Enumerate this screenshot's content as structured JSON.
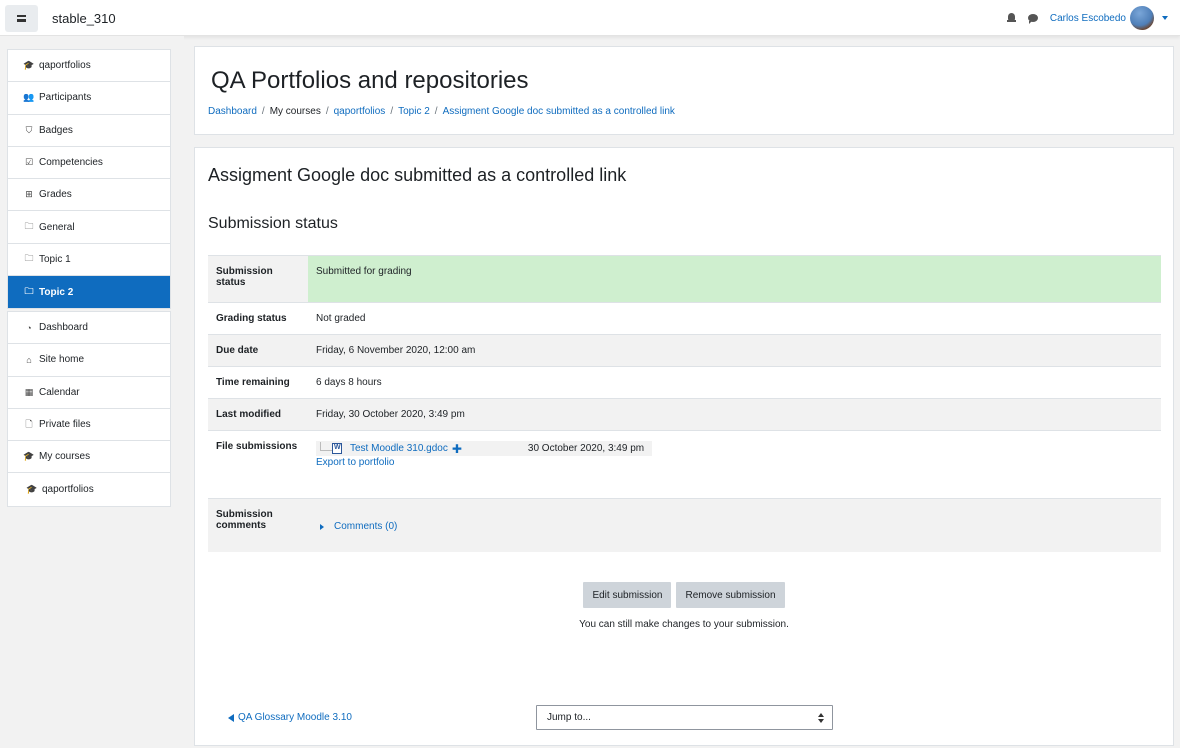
{
  "navbar": {
    "site_name": "stable_310",
    "user_name": "Carlos Escobedo"
  },
  "drawer": {
    "course_group": [
      {
        "label": "qaportfolios",
        "icon": "graduation-cap-icon"
      },
      {
        "label": "Participants",
        "icon": "users-icon"
      },
      {
        "label": "Badges",
        "icon": "shield-icon"
      },
      {
        "label": "Competencies",
        "icon": "check-square-icon"
      },
      {
        "label": "Grades",
        "icon": "table-icon"
      },
      {
        "label": "General",
        "icon": "folder-icon"
      },
      {
        "label": "Topic 1",
        "icon": "folder-icon"
      },
      {
        "label": "Topic 2",
        "icon": "folder-icon",
        "active": true
      }
    ],
    "site_group": [
      {
        "label": "Dashboard",
        "icon": "dashboard-icon"
      },
      {
        "label": "Site home",
        "icon": "home-icon"
      },
      {
        "label": "Calendar",
        "icon": "calendar-icon"
      },
      {
        "label": "Private files",
        "icon": "file-icon"
      },
      {
        "label": "My courses",
        "icon": "graduation-cap-icon"
      },
      {
        "label": "qaportfolios",
        "icon": "graduation-cap-icon",
        "sub": true
      }
    ]
  },
  "header": {
    "title": "QA Portfolios and repositories",
    "breadcrumb": [
      "Dashboard",
      "My courses",
      "qaportfolios",
      "Topic 2",
      "Assigment Google doc submitted as a controlled link"
    ]
  },
  "main": {
    "activity_title": "Assigment Google doc submitted as a controlled link",
    "section_title": "Submission status",
    "rows": {
      "submission_status": {
        "label": "Submission status",
        "value": "Submitted for grading"
      },
      "grading_status": {
        "label": "Grading status",
        "value": "Not graded"
      },
      "due_date": {
        "label": "Due date",
        "value": "Friday, 6 November 2020, 12:00 am"
      },
      "time_remaining": {
        "label": "Time remaining",
        "value": "6 days 8 hours"
      },
      "last_modified": {
        "label": "Last modified",
        "value": "Friday, 30 October 2020, 3:49 pm"
      },
      "file_submissions": {
        "label": "File submissions",
        "file_name": "Test Moodle 310.gdoc",
        "plus": "✚",
        "file_date": "30 October 2020, 3:49 pm",
        "export_label": "Export to portfolio"
      },
      "submission_comments": {
        "label": "Submission comments",
        "value": "Comments (0)"
      }
    },
    "buttons": {
      "edit": "Edit submission",
      "remove": "Remove submission"
    },
    "note": "You can still make changes to your submission.",
    "prev_link": "QA Glossary Moodle 3.10",
    "jump_select": "Jump to..."
  },
  "colors": {
    "accent": "#0f6cbf",
    "submitted_bg": "#cfefcf"
  }
}
